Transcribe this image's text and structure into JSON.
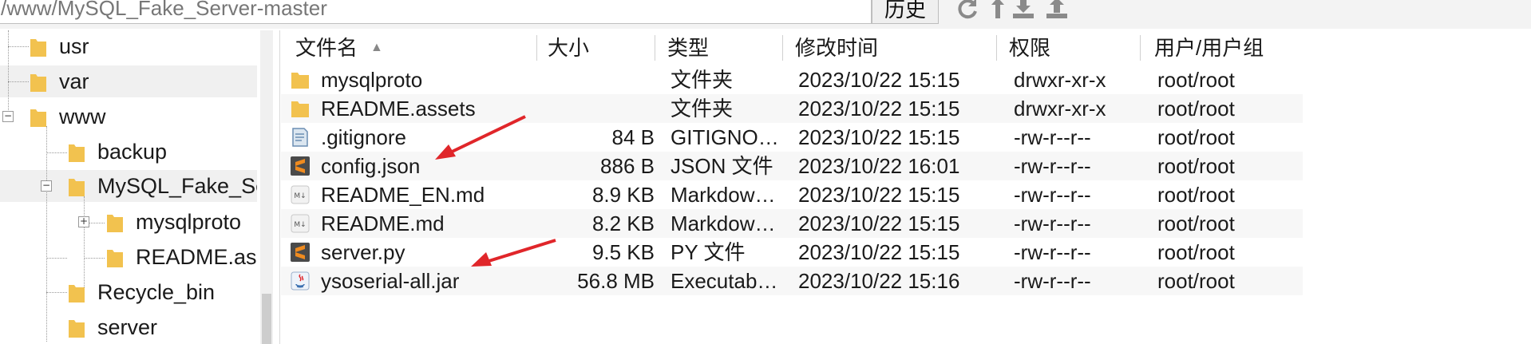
{
  "toolbar": {
    "path": "/www/MySQL_Fake_Server-master",
    "history_label": "历史",
    "icons": [
      "refresh-icon",
      "up-folder-icon",
      "download-icon",
      "upload-icon"
    ]
  },
  "tree": {
    "items": [
      {
        "label": "usr",
        "level": 0
      },
      {
        "label": "var",
        "level": 0
      },
      {
        "label": "www",
        "level": 0,
        "expander": "−"
      },
      {
        "label": "backup",
        "level": 1
      },
      {
        "label": "MySQL_Fake_Ser",
        "level": 1,
        "expander": "−"
      },
      {
        "label": "mysqlproto",
        "level": 2,
        "expander": "+"
      },
      {
        "label": "README.ass",
        "level": 2
      },
      {
        "label": "Recycle_bin",
        "level": 1
      },
      {
        "label": "server",
        "level": 1
      }
    ]
  },
  "list": {
    "columns": {
      "name": "文件名",
      "size": "大小",
      "type": "类型",
      "modified": "修改时间",
      "perm": "权限",
      "owner": "用户/用户组"
    },
    "sort_indicator": "▲",
    "rows": [
      {
        "name": "mysqlproto",
        "size": "",
        "type": "文件夹",
        "modified": "2023/10/22 15:15",
        "perm": "drwxr-xr-x",
        "owner": "root/root",
        "icon": "folder-icon"
      },
      {
        "name": "README.assets",
        "size": "",
        "type": "文件夹",
        "modified": "2023/10/22 15:15",
        "perm": "drwxr-xr-x",
        "owner": "root/root",
        "icon": "folder-icon"
      },
      {
        "name": ".gitignore",
        "size": "84 B",
        "type": "GITIGNO…",
        "modified": "2023/10/22 15:15",
        "perm": "-rw-r--r--",
        "owner": "root/root",
        "icon": "text-file-icon"
      },
      {
        "name": "config.json",
        "size": "886 B",
        "type": "JSON 文件",
        "modified": "2023/10/22 16:01",
        "perm": "-rw-r--r--",
        "owner": "root/root",
        "icon": "sublime-file-icon"
      },
      {
        "name": "README_EN.md",
        "size": "8.9 KB",
        "type": "Markdow…",
        "modified": "2023/10/22 15:15",
        "perm": "-rw-r--r--",
        "owner": "root/root",
        "icon": "markdown-file-icon"
      },
      {
        "name": "README.md",
        "size": "8.2 KB",
        "type": "Markdow…",
        "modified": "2023/10/22 15:15",
        "perm": "-rw-r--r--",
        "owner": "root/root",
        "icon": "markdown-file-icon"
      },
      {
        "name": "server.py",
        "size": "9.5 KB",
        "type": "PY 文件",
        "modified": "2023/10/22 15:15",
        "perm": "-rw-r--r--",
        "owner": "root/root",
        "icon": "sublime-file-icon"
      },
      {
        "name": "ysoserial-all.jar",
        "size": "56.8 MB",
        "type": "Executab…",
        "modified": "2023/10/22 15:16",
        "perm": "-rw-r--r--",
        "owner": "root/root",
        "icon": "java-file-icon"
      }
    ]
  },
  "colors": {
    "folder": "#f2c24f",
    "arrow": "#e0262a",
    "sublime": "#f08b1f"
  }
}
